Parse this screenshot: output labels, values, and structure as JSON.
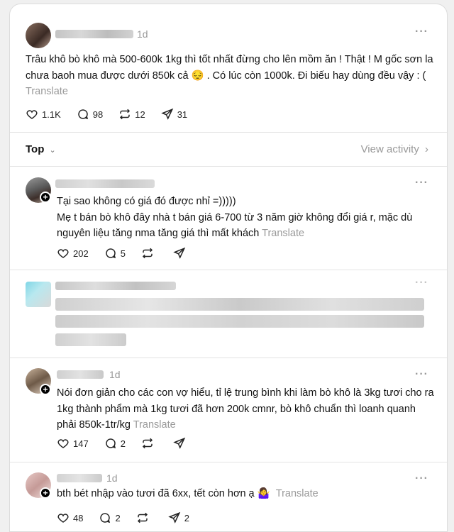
{
  "post": {
    "time": "1d",
    "text": "Trâu khô bò khô mà 500-600k 1kg thì tốt nhất đừng cho lên mồm ăn ! Thật ! M gốc sơn la chưa baoh mua được dưới 850k cả 😔 . Có lúc còn 1000k. Đi biếu hay dùng đều vậy : (",
    "translate": "Translate",
    "likes": "1.1K",
    "comments": "98",
    "reposts": "12",
    "shares": "31"
  },
  "tabs": {
    "sort_label": "Top",
    "view_activity": "View activity"
  },
  "replies": [
    {
      "text": "Tại sao không có giá đó được nhỉ =)))))\nMẹ t bán bò khô đây nhà t bán giá 6-700 từ 3 năm giờ không đổi giá r, mặc dù nguyên liệu tăng nma tăng giá thì mất khách",
      "translate": "Translate",
      "likes": "202",
      "comments": "5"
    },
    {
      "time": "1d",
      "text": "Nói đơn giản cho các con vợ hiểu, tỉ lệ trung bình khi làm bò khô là 3kg tươi cho ra 1kg thành phẩm mà 1kg tươi đã hơn 200k cmnr, bò khô chuẩn thì loanh quanh phải 850k-1tr/kg",
      "translate": "Translate",
      "likes": "147",
      "comments": "2"
    },
    {
      "time": "1d",
      "text": "bth bét nhập vào tươi đã 6xx, tết còn hơn ạ 🤷‍♀️",
      "translate": "Translate",
      "likes": "48",
      "comments": "2",
      "shares": "2"
    }
  ]
}
